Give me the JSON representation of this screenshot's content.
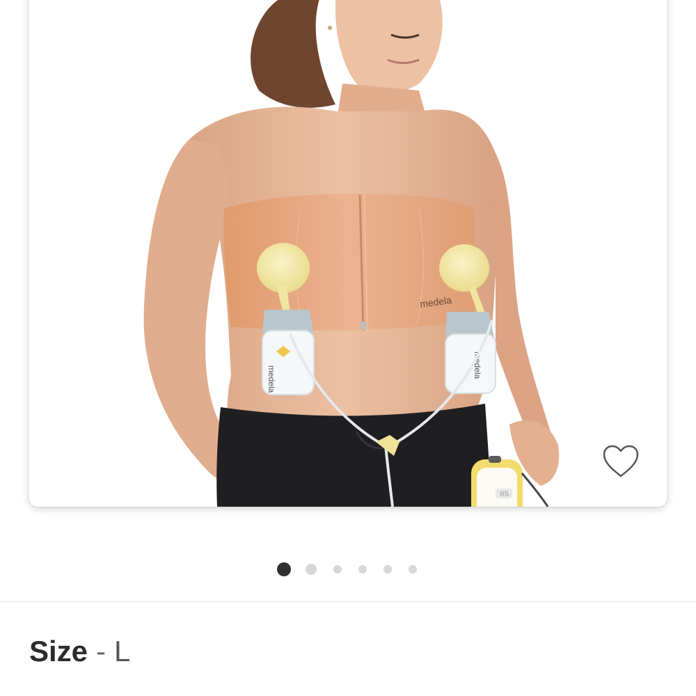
{
  "product": {
    "image_alt": "Model wearing hands-free pumping bra with breast pump",
    "photo_text": "medela",
    "pump_display": "05"
  },
  "favorite": {
    "icon": "heart-outline-icon",
    "active": false
  },
  "carousel": {
    "total": 6,
    "current": 1
  },
  "size": {
    "label": "Size",
    "separator": "-",
    "value": "L"
  },
  "colors": {
    "skin": "#e8b99a",
    "bra": "#e8ad86",
    "pump_yellow": "#f3e7a6",
    "pants": "#1f1f22",
    "hair": "#6e4630",
    "active_dot": "#303030",
    "inactive_dot": "#d7d7d7"
  }
}
